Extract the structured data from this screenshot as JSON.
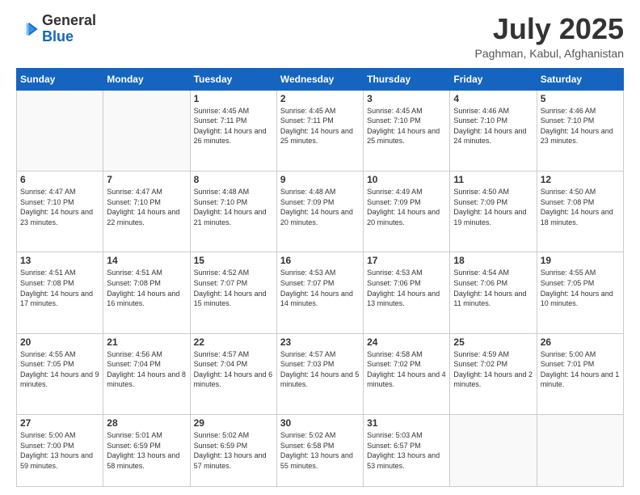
{
  "header": {
    "logo_general": "General",
    "logo_blue": "Blue",
    "main_title": "July 2025",
    "subtitle": "Paghman, Kabul, Afghanistan"
  },
  "calendar": {
    "days_of_week": [
      "Sunday",
      "Monday",
      "Tuesday",
      "Wednesday",
      "Thursday",
      "Friday",
      "Saturday"
    ],
    "weeks": [
      [
        {
          "day": "",
          "empty": true
        },
        {
          "day": "",
          "empty": true
        },
        {
          "day": "1",
          "sunrise": "4:45 AM",
          "sunset": "7:11 PM",
          "daylight": "14 hours and 26 minutes."
        },
        {
          "day": "2",
          "sunrise": "4:45 AM",
          "sunset": "7:11 PM",
          "daylight": "14 hours and 25 minutes."
        },
        {
          "day": "3",
          "sunrise": "4:45 AM",
          "sunset": "7:10 PM",
          "daylight": "14 hours and 25 minutes."
        },
        {
          "day": "4",
          "sunrise": "4:46 AM",
          "sunset": "7:10 PM",
          "daylight": "14 hours and 24 minutes."
        },
        {
          "day": "5",
          "sunrise": "4:46 AM",
          "sunset": "7:10 PM",
          "daylight": "14 hours and 23 minutes."
        }
      ],
      [
        {
          "day": "6",
          "sunrise": "4:47 AM",
          "sunset": "7:10 PM",
          "daylight": "14 hours and 23 minutes."
        },
        {
          "day": "7",
          "sunrise": "4:47 AM",
          "sunset": "7:10 PM",
          "daylight": "14 hours and 22 minutes."
        },
        {
          "day": "8",
          "sunrise": "4:48 AM",
          "sunset": "7:10 PM",
          "daylight": "14 hours and 21 minutes."
        },
        {
          "day": "9",
          "sunrise": "4:48 AM",
          "sunset": "7:09 PM",
          "daylight": "14 hours and 20 minutes."
        },
        {
          "day": "10",
          "sunrise": "4:49 AM",
          "sunset": "7:09 PM",
          "daylight": "14 hours and 20 minutes."
        },
        {
          "day": "11",
          "sunrise": "4:50 AM",
          "sunset": "7:09 PM",
          "daylight": "14 hours and 19 minutes."
        },
        {
          "day": "12",
          "sunrise": "4:50 AM",
          "sunset": "7:08 PM",
          "daylight": "14 hours and 18 minutes."
        }
      ],
      [
        {
          "day": "13",
          "sunrise": "4:51 AM",
          "sunset": "7:08 PM",
          "daylight": "14 hours and 17 minutes."
        },
        {
          "day": "14",
          "sunrise": "4:51 AM",
          "sunset": "7:08 PM",
          "daylight": "14 hours and 16 minutes."
        },
        {
          "day": "15",
          "sunrise": "4:52 AM",
          "sunset": "7:07 PM",
          "daylight": "14 hours and 15 minutes."
        },
        {
          "day": "16",
          "sunrise": "4:53 AM",
          "sunset": "7:07 PM",
          "daylight": "14 hours and 14 minutes."
        },
        {
          "day": "17",
          "sunrise": "4:53 AM",
          "sunset": "7:06 PM",
          "daylight": "14 hours and 13 minutes."
        },
        {
          "day": "18",
          "sunrise": "4:54 AM",
          "sunset": "7:06 PM",
          "daylight": "14 hours and 11 minutes."
        },
        {
          "day": "19",
          "sunrise": "4:55 AM",
          "sunset": "7:05 PM",
          "daylight": "14 hours and 10 minutes."
        }
      ],
      [
        {
          "day": "20",
          "sunrise": "4:55 AM",
          "sunset": "7:05 PM",
          "daylight": "14 hours and 9 minutes."
        },
        {
          "day": "21",
          "sunrise": "4:56 AM",
          "sunset": "7:04 PM",
          "daylight": "14 hours and 8 minutes."
        },
        {
          "day": "22",
          "sunrise": "4:57 AM",
          "sunset": "7:04 PM",
          "daylight": "14 hours and 6 minutes."
        },
        {
          "day": "23",
          "sunrise": "4:57 AM",
          "sunset": "7:03 PM",
          "daylight": "14 hours and 5 minutes."
        },
        {
          "day": "24",
          "sunrise": "4:58 AM",
          "sunset": "7:02 PM",
          "daylight": "14 hours and 4 minutes."
        },
        {
          "day": "25",
          "sunrise": "4:59 AM",
          "sunset": "7:02 PM",
          "daylight": "14 hours and 2 minutes."
        },
        {
          "day": "26",
          "sunrise": "5:00 AM",
          "sunset": "7:01 PM",
          "daylight": "14 hours and 1 minute."
        }
      ],
      [
        {
          "day": "27",
          "sunrise": "5:00 AM",
          "sunset": "7:00 PM",
          "daylight": "13 hours and 59 minutes."
        },
        {
          "day": "28",
          "sunrise": "5:01 AM",
          "sunset": "6:59 PM",
          "daylight": "13 hours and 58 minutes."
        },
        {
          "day": "29",
          "sunrise": "5:02 AM",
          "sunset": "6:59 PM",
          "daylight": "13 hours and 57 minutes."
        },
        {
          "day": "30",
          "sunrise": "5:02 AM",
          "sunset": "6:58 PM",
          "daylight": "13 hours and 55 minutes."
        },
        {
          "day": "31",
          "sunrise": "5:03 AM",
          "sunset": "6:57 PM",
          "daylight": "13 hours and 53 minutes."
        },
        {
          "day": "",
          "empty": true
        },
        {
          "day": "",
          "empty": true
        }
      ]
    ]
  }
}
